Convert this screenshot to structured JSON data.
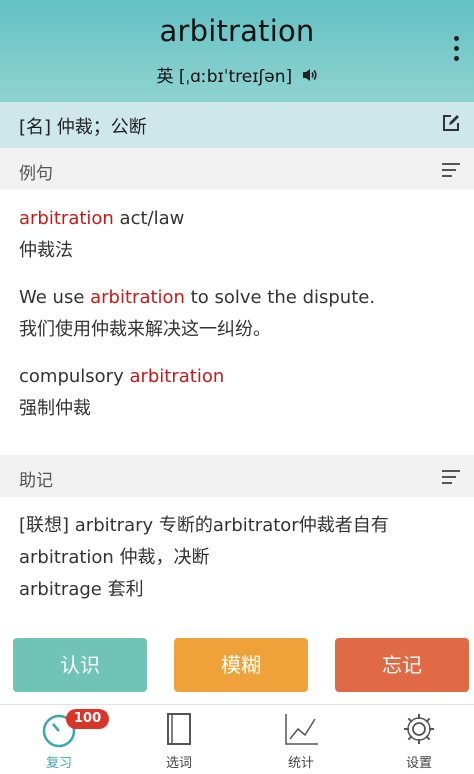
{
  "header": {
    "word": "arbitration",
    "phonetic": "英 [ˌɑːbɪˈtreɪʃən]"
  },
  "meaning": "[名] 仲裁；公断",
  "sections": {
    "examples_title": "例句",
    "mnemonic_title": "助记"
  },
  "examples": [
    {
      "en_pre": "",
      "en_hl": "arbitration",
      "en_post": " act/law",
      "zh": "仲裁法"
    },
    {
      "en_pre": "We use ",
      "en_hl": "arbitration",
      "en_post": " to solve the dispute.",
      "zh": "我们使用仲裁来解决这一纠纷。"
    },
    {
      "en_pre": "compulsory ",
      "en_hl": "arbitration",
      "en_post": "",
      "zh": "强制仲裁"
    }
  ],
  "mnemonic": {
    "line1": "[联想] arbitrary 专断的arbitrator仲裁者自有",
    "line2": "arbitration 仲裁，决断",
    "line3": "arbitrage 套利"
  },
  "buttons": {
    "know": "认识",
    "vague": "模糊",
    "forget": "忘记"
  },
  "tabs": [
    {
      "label": "复习",
      "badge": "100"
    },
    {
      "label": "选词"
    },
    {
      "label": "统计"
    },
    {
      "label": "设置"
    }
  ],
  "colors": {
    "header": "#62c1c4",
    "highlight": "#c51a1a",
    "know": "#6fc4b6",
    "vague": "#f0a23a",
    "forget": "#e06a45",
    "active_tab": "#37a9ad"
  }
}
